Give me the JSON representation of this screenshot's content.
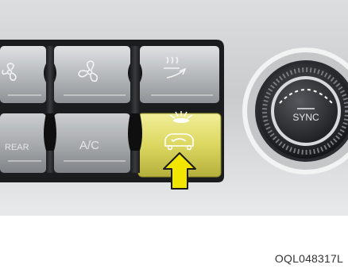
{
  "buttons": {
    "rear_defrost_label": "REAR",
    "ac_label": "A/C",
    "sync_label": "SYNC"
  },
  "icons": {
    "top_left": "fan-icon-partial",
    "top_middle": "fan-icon",
    "top_right": "defrost-airflow-icon",
    "recirculation": "air-recirculation-icon",
    "indicator": "indicator-light-on",
    "pointer": "yellow-arrow-up"
  },
  "colors": {
    "indicator_highlight": "#e8e46a",
    "arrow": "#f2e600",
    "panel_dark": "#1b1c1e",
    "button_silver": "#b9bcbf"
  },
  "figure": {
    "code": "OQL048317L"
  }
}
